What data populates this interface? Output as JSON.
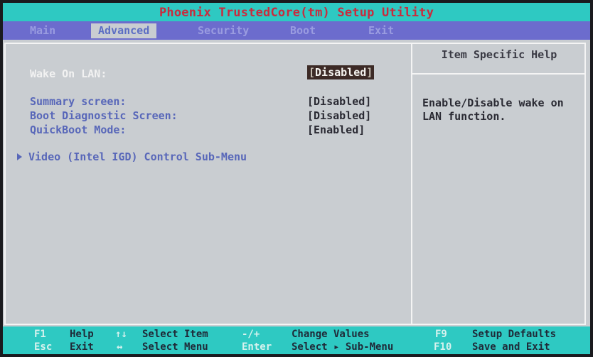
{
  "title": "Phoenix TrustedCore(tm) Setup Utility",
  "menu": {
    "tabs": [
      {
        "label": "Main",
        "active": false
      },
      {
        "label": "Advanced",
        "active": true
      },
      {
        "label": "Security",
        "active": false
      },
      {
        "label": "Boot",
        "active": false
      },
      {
        "label": "Exit",
        "active": false
      }
    ]
  },
  "settings": {
    "wake_on_lan": {
      "label": "Wake On LAN:",
      "value": "Disabled",
      "selected": true
    },
    "items": [
      {
        "label": "Summary screen:",
        "value": "[Disabled]"
      },
      {
        "label": "Boot Diagnostic Screen:",
        "value": "[Disabled]"
      },
      {
        "label": "QuickBoot Mode:",
        "value": "[Enabled]"
      }
    ],
    "submenu": {
      "label": "Video (Intel IGD) Control Sub-Menu"
    }
  },
  "help": {
    "header": "Item Specific Help",
    "text": "Enable/Disable wake on\nLAN function."
  },
  "footer": {
    "row1": [
      {
        "key": "F1",
        "desc": "Help"
      },
      {
        "key": "↑↓",
        "desc": "Select Item"
      },
      {
        "key": "-/+",
        "desc": "Change Values"
      },
      {
        "key": "F9",
        "desc": "Setup Defaults"
      }
    ],
    "row2": [
      {
        "key": "Esc",
        "desc": "Exit"
      },
      {
        "key": "↔",
        "desc": "Select Menu"
      },
      {
        "key": "Enter",
        "desc": "Select ▸ Sub-Menu"
      },
      {
        "key": "F10",
        "desc": "Save and Exit"
      }
    ]
  },
  "colors": {
    "title_bg": "#2ec9c2",
    "title_text": "#c92b3d",
    "menu_bg": "#6c6ccd",
    "body_bg": "#c9cdd1",
    "label_blue": "#5867b9",
    "selected_bg": "#3c2a26"
  }
}
